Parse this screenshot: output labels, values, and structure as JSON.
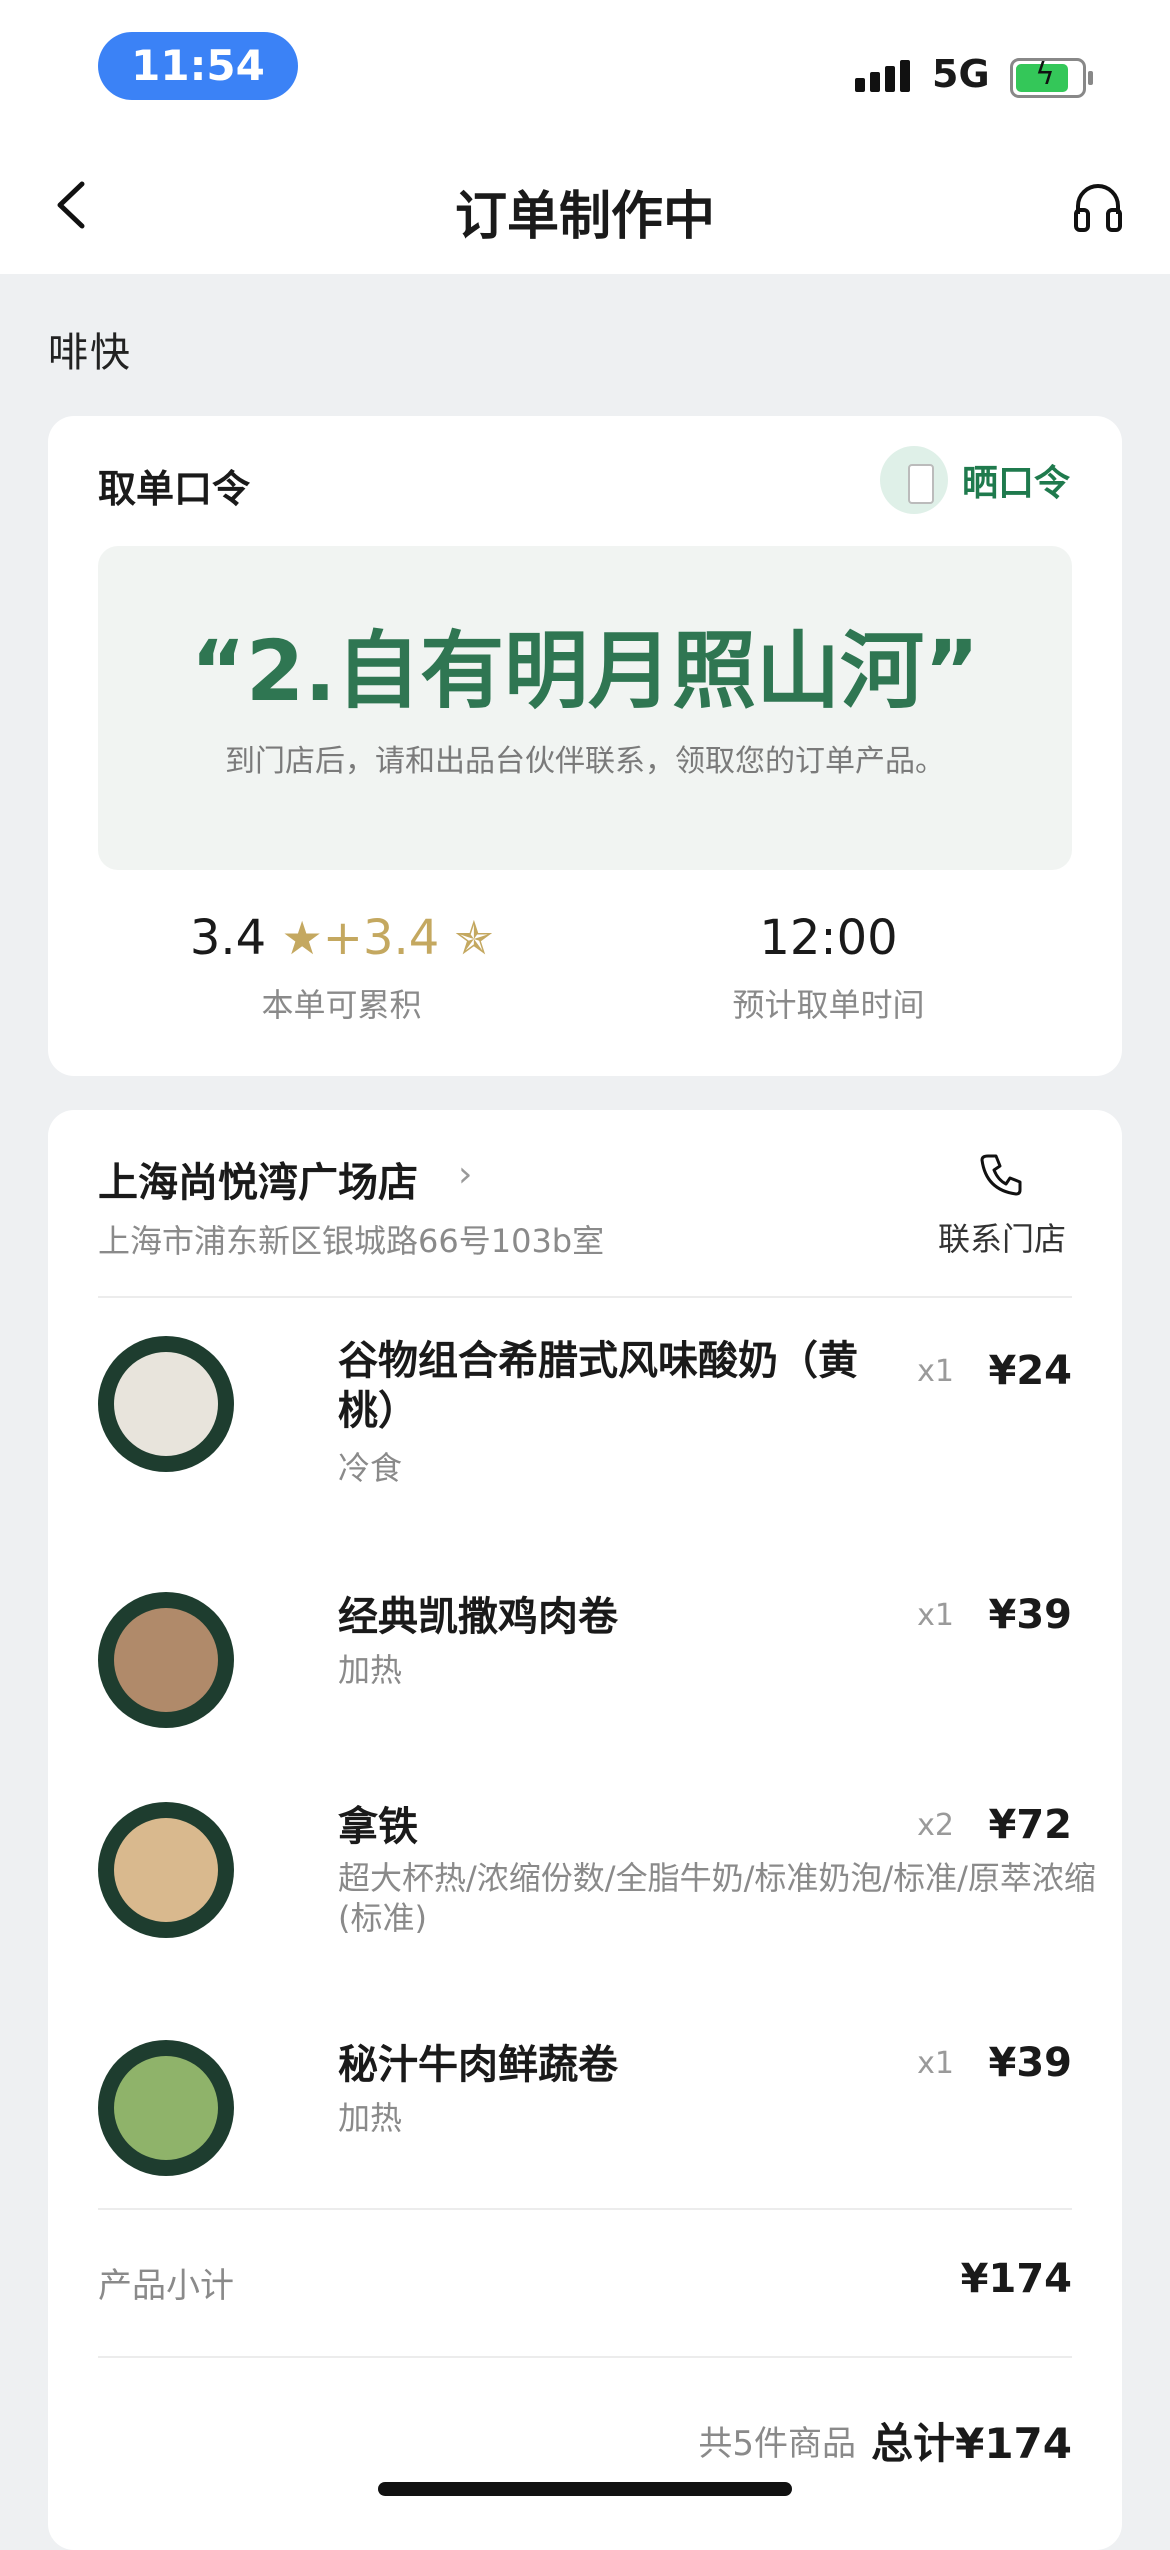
{
  "status_bar": {
    "time": "11:54",
    "network": "5G",
    "battery_icon": "battery-charging-icon"
  },
  "nav": {
    "title": "订单制作中",
    "back_icon": "chevron-left-icon",
    "support_icon": "headset-icon"
  },
  "brand": {
    "logo_text": "啡快"
  },
  "pickup": {
    "title": "取单口令",
    "share_label": "晒口令",
    "code": "“2.自有明月照山河”",
    "hint": "到门店后，请和出品台伙伴联系，领取您的订单产品。",
    "stars": {
      "base": "3.4",
      "plus": "+3.4",
      "label": "本单可累积",
      "accent": "#c4a860"
    },
    "pickup_time": {
      "value": "12:00",
      "label": "预计取单时间"
    }
  },
  "store": {
    "name": "上海尚悦湾广场店",
    "address": "上海市浦东新区银城路66号103b室",
    "contact_label": "联系门店"
  },
  "items": [
    {
      "name": "谷物组合希腊式风味酸奶（黄桃）",
      "sub": "冷食",
      "qty": "x1",
      "price": "¥24"
    },
    {
      "name": "经典凯撒鸡肉卷",
      "sub": "加热",
      "qty": "x1",
      "price": "¥39"
    },
    {
      "name": "拿铁",
      "sub": "超大杯热/浓缩份数/全脂牛奶/标准奶泡/标准/原萃浓缩(标准)",
      "qty": "x2",
      "price": "¥72"
    },
    {
      "name": "秘汁牛肉鲜蔬卷",
      "sub": "加热",
      "qty": "x1",
      "price": "¥39"
    }
  ],
  "summary": {
    "subtotal_label": "产品小计",
    "subtotal": "¥174",
    "count_text": "共5件商品",
    "total_text": "总计¥174"
  },
  "colors": {
    "brand_green": "#2f7652",
    "time_pill": "#3b82f6"
  }
}
